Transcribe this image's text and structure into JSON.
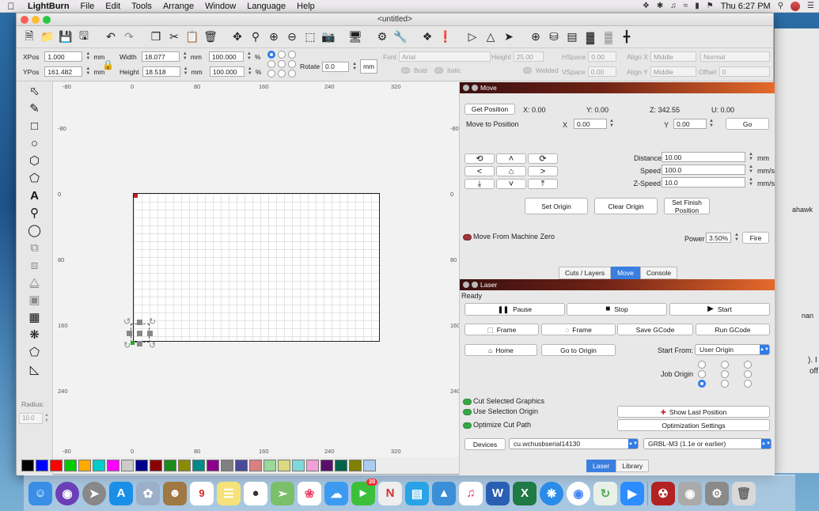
{
  "menubar": {
    "app": "LightBurn",
    "items": [
      "File",
      "Edit",
      "Tools",
      "Arrange",
      "Window",
      "Language",
      "Help"
    ],
    "clock": "Thu 6:27 PM"
  },
  "window": {
    "title": "<untitled>"
  },
  "toolbar2": {
    "xpos_label": "XPos",
    "xpos": "1.000",
    "ypos_label": "YPos",
    "ypos": "161.482",
    "unit": "mm",
    "width_label": "Width",
    "width": "18.077",
    "height_label": "Height",
    "height": "18.518",
    "wpct": "100.000",
    "hpct": "100.000",
    "pct": "%",
    "rotate_label": "Rotate",
    "rotate": "0.0",
    "mm_btn": "mm",
    "font_label": "Font",
    "font": "Arial",
    "fheight_label": "Height",
    "fheight": "25.00",
    "hspace_label": "HSpace",
    "hspace": "0.00",
    "vspace_label": "VSpace",
    "vspace": "0.00",
    "alignx_label": "Align X",
    "alignx": "Middle",
    "aligny_label": "Align Y",
    "aligny": "Middle",
    "normal": "Normal",
    "offset_label": "Offset",
    "offset": "0",
    "bold": "Bold",
    "italic": "Italic",
    "welded": "Welded"
  },
  "palette": {
    "radius_label": "Radius:",
    "radius": "10.0"
  },
  "rulers": {
    "top": [
      "-80",
      "0",
      "80",
      "160",
      "240",
      "320"
    ],
    "left": [
      "-80",
      "0",
      "80",
      "160",
      "240"
    ],
    "bottom": [
      "-80",
      "0",
      "80",
      "160",
      "240",
      "320"
    ]
  },
  "move": {
    "title": "Move",
    "get_position": "Get Position",
    "x": "X: 0.00",
    "y": "Y: 0.00",
    "z": "Z: 342.55",
    "u": "U: 0.00",
    "move_to": "Move to Position",
    "x_label": "X",
    "x_val": "0.00",
    "y_label": "Y",
    "y_val": "0.00",
    "go": "Go",
    "distance_label": "Distance",
    "distance": "10.00",
    "speed_label": "Speed",
    "speed": "100.0",
    "zspeed_label": "Z-Speed",
    "zspeed": "10.0",
    "unit_mm": "mm",
    "unit_mms": "mm/s",
    "set_origin": "Set Origin",
    "clear_origin": "Clear Origin",
    "set_finish": "Set Finish Position",
    "machine_zero": "Move From Machine Zero",
    "power_label": "Power",
    "power": "3.50%",
    "fire": "Fire"
  },
  "tabs_top": [
    "Cuts / Layers",
    "Move",
    "Console"
  ],
  "laser": {
    "title": "Laser",
    "status": "Ready",
    "pause": "Pause",
    "stop": "Stop",
    "start": "Start",
    "frame1": "Frame",
    "frame2": "Frame",
    "save_gcode": "Save GCode",
    "run_gcode": "Run GCode",
    "home": "Home",
    "go_origin": "Go to Origin",
    "start_from_label": "Start From:",
    "start_from": "User Origin",
    "job_origin": "Job Origin",
    "cut_selected": "Cut Selected Graphics",
    "use_selection": "Use Selection Origin",
    "optimize": "Optimize Cut Path",
    "show_last": "Show Last Position",
    "opt_settings": "Optimization Settings",
    "devices": "Devices",
    "port": "cu.wchusbserial14130",
    "device": "GRBL-M3 (1.1e or earlier)"
  },
  "tabs_bottom": [
    "Laser",
    "Library"
  ],
  "bg_text": {
    "t1": "ahawk",
    "t2": "nan",
    "t3": "). I",
    "t4": "off"
  },
  "swatches": [
    "#000000",
    "#0000ff",
    "#ff0000",
    "#00cc00",
    "#ffaa00",
    "#00cccc",
    "#ff00ff",
    "#cccccc",
    "#00008b",
    "#8b0000",
    "#1d8a1d",
    "#8b8b00",
    "#008b8b",
    "#8b008b",
    "#808080",
    "#4a4a9a",
    "#d98080",
    "#9ad99a",
    "#d9d980",
    "#80d9d9",
    "#f4a0d8",
    "#5a0f6b",
    "#00644b",
    "#808000",
    "#aaccee"
  ],
  "dock_badge": "20"
}
